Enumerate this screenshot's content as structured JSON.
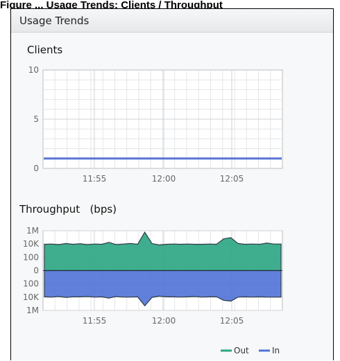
{
  "figure_caption": "Figure ... Usage Trends: Clients / Throughput",
  "panel": {
    "title": "Usage Trends"
  },
  "clients_chart": {
    "title": "Clients",
    "chart_data": {
      "type": "line",
      "title": "Clients",
      "x_ticks": [
        "11:55",
        "12:00",
        "12:05"
      ],
      "y_ticks": [
        "10",
        "5",
        "0"
      ],
      "ylim": [
        0,
        10
      ],
      "series": [
        {
          "name": "",
          "color": "#5a73d6",
          "x": [
            "11:51",
            "12:08"
          ],
          "values": [
            1,
            1
          ]
        }
      ],
      "grid": true
    }
  },
  "throughput_chart": {
    "title": "Throughput",
    "unit": "(bps)",
    "chart_data": {
      "type": "area",
      "title": "Throughput (bps)",
      "x_ticks": [
        "11:55",
        "12:00",
        "12:05"
      ],
      "y_ticks": [
        "1M",
        "10K",
        "100",
        "0",
        "100",
        "10K",
        "1M"
      ],
      "scale": "log-mirrored",
      "grid": true,
      "legend": {
        "placement": "bottom-right"
      },
      "series": [
        {
          "name": "Out",
          "color": "#2aa583",
          "values": [
            9000,
            10000,
            8000,
            12000,
            9000,
            11000,
            8000,
            10000,
            9000,
            18000,
            8000,
            10000,
            12000,
            9000,
            600000,
            12000,
            7000,
            9000,
            10000,
            9000,
            10000,
            9000,
            9000,
            10000,
            9000,
            60000,
            90000,
            12000,
            9000,
            10000,
            9000,
            14000,
            10000,
            10000
          ]
        },
        {
          "name": "In",
          "color": "#4f72d8",
          "values": [
            9000,
            10000,
            8000,
            11000,
            9000,
            9000,
            8000,
            10000,
            9000,
            14000,
            8000,
            10000,
            10000,
            9000,
            200000,
            11000,
            7000,
            9000,
            9000,
            10000,
            9000,
            8000,
            10000,
            9000,
            9000,
            30000,
            40000,
            10000,
            9000,
            10000,
            9000,
            10000,
            10000,
            10000
          ]
        }
      ]
    }
  }
}
